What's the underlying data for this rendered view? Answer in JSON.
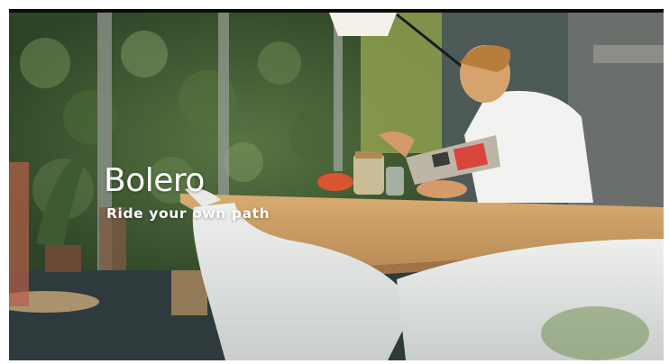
{
  "brand": {
    "logo_text": "Bolero",
    "tagline": "Ride your own path"
  },
  "scene": {
    "description_icons": [
      "plant-wall-icon",
      "person-reading-icon",
      "dining-table-icon",
      "chair-icon"
    ],
    "colors": {
      "foliage": "#3f5a35",
      "table_wood": "#c89a62",
      "chair_white": "#e6e8e6",
      "shirt": "#f2f2f0",
      "floor": "#2f3a3c"
    }
  }
}
